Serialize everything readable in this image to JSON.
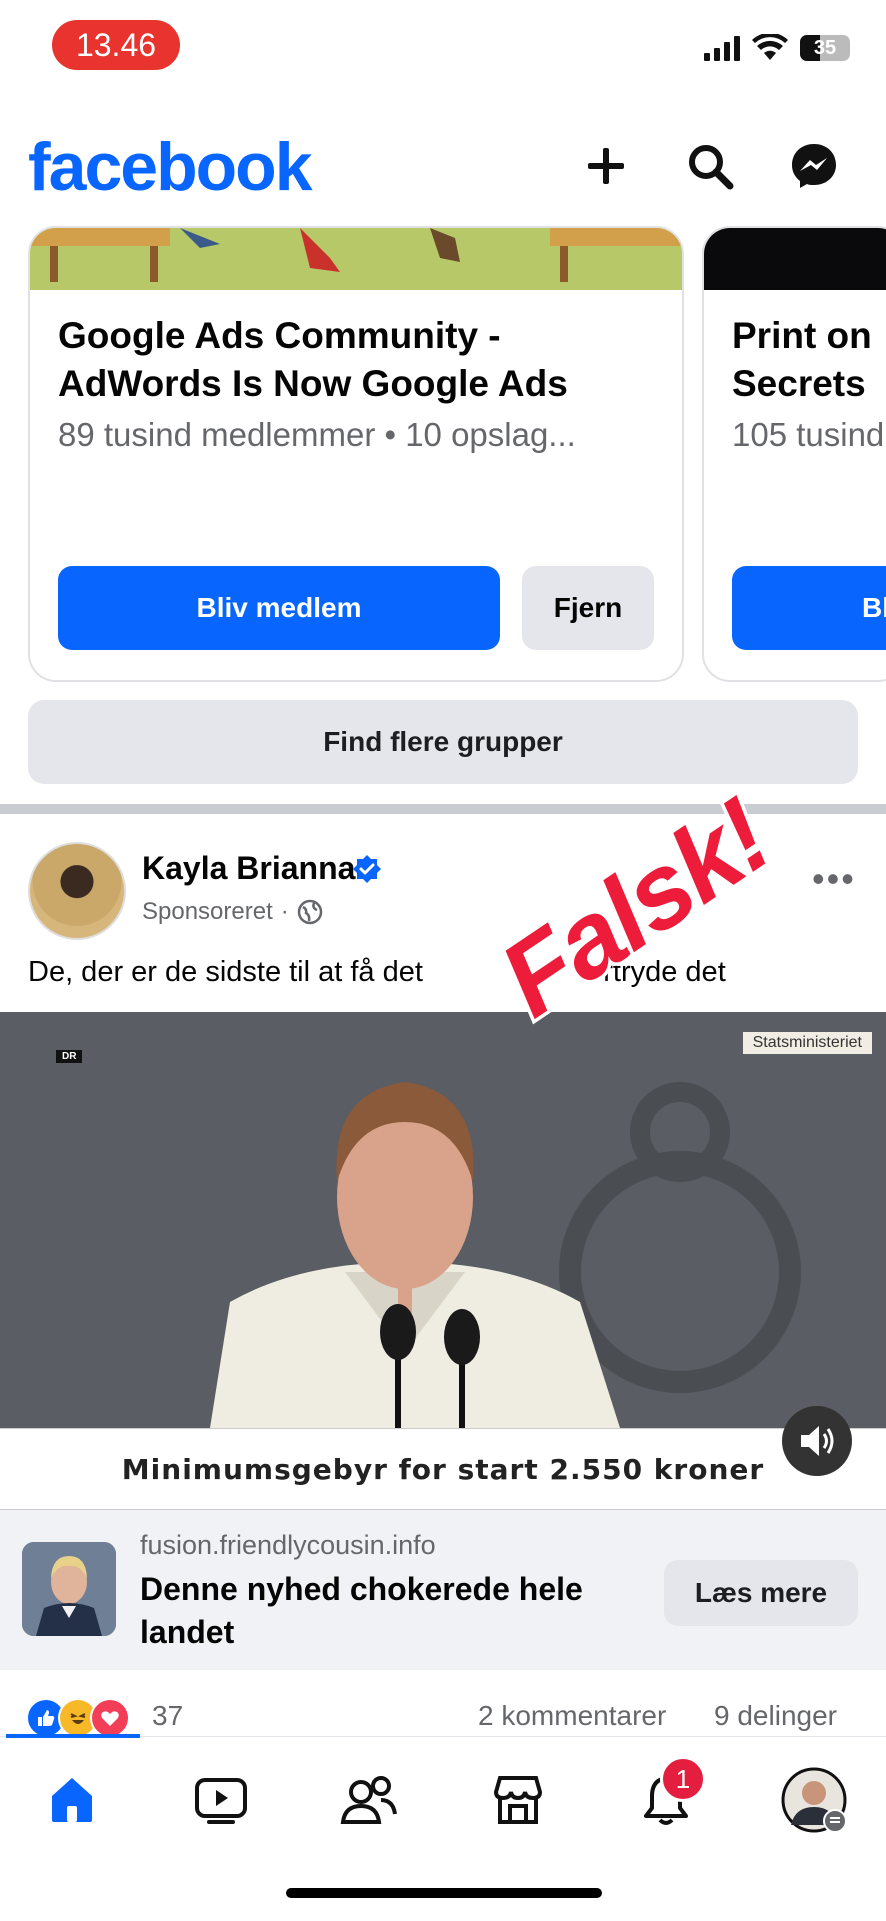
{
  "status_bar": {
    "time": "13.46",
    "battery": "35"
  },
  "header": {
    "brand": "facebook",
    "icons": [
      "plus-icon",
      "search-icon",
      "messenger-icon"
    ]
  },
  "groups": [
    {
      "title": "Google Ads Community -AdWords Is Now Google Ads",
      "meta": "89 tusind medlemmer • 10 opslag...",
      "join_label": "Bliv medlem",
      "remove_label": "Fjern"
    },
    {
      "title": "Print on Secrets",
      "meta": "105 tusind",
      "join_label": "Bl"
    }
  ],
  "find_more_label": "Find flere grupper",
  "post": {
    "author": "Kayla Brianna",
    "sponsored": "Sponsoreret",
    "caption": "De, der er de sidste til at få det",
    "caption_tail": "fortryde det",
    "video": {
      "top_left_logo": "DR",
      "top_right_label": "Statsministeriet",
      "bottom_caption": "Minimumsgebyr for start 2.550 kroner"
    },
    "link": {
      "domain": "fusion.friendlycousin.info",
      "title": "Denne nyhed chokerede hele landet",
      "cta": "Læs mere"
    },
    "reaction_count": "37",
    "comments": "2 kommentarer",
    "shares": "9 delinger"
  },
  "overlay_stamp": "Falsk!",
  "bottom_nav": {
    "items": [
      "home-icon",
      "video-icon",
      "friends-icon",
      "marketplace-icon",
      "bell-icon",
      "profile-avatar"
    ],
    "notification_count": "1"
  },
  "colors": {
    "brand": "#0866ff",
    "stamp": "#ec1c3a",
    "status_time_bg": "#e8332f"
  }
}
